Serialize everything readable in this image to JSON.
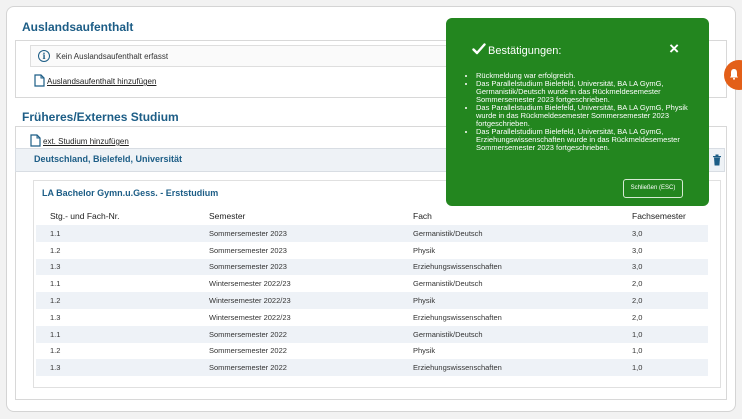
{
  "auslandsaufenthalt": {
    "title": "Auslandsaufenthalt",
    "empty_text": "Kein Auslandsaufenthalt erfasst",
    "add_link": "Auslandsaufenthalt hinzufügen"
  },
  "studium": {
    "title": "Früheres/Externes Studium",
    "add_link": "ext. Studium hinzufügen",
    "institution": "Deutschland, Bielefeld, Universität",
    "program": "LA Bachelor Gymn.u.Gess. - Erststudium",
    "columns": [
      "Stg.- und Fach-Nr.",
      "Semester",
      "Fach",
      "Fachsemester"
    ],
    "rows": [
      [
        "1.1",
        "Sommersemester 2023",
        "Germanistik/Deutsch",
        "3,0"
      ],
      [
        "1.2",
        "Sommersemester 2023",
        "Physik",
        "3,0"
      ],
      [
        "1.3",
        "Sommersemester 2023",
        "Erziehungswissenschaften",
        "3,0"
      ],
      [
        "1.1",
        "Wintersemester 2022/23",
        "Germanistik/Deutsch",
        "2,0"
      ],
      [
        "1.2",
        "Wintersemester 2022/23",
        "Physik",
        "2,0"
      ],
      [
        "1.3",
        "Wintersemester 2022/23",
        "Erziehungswissenschaften",
        "2,0"
      ],
      [
        "1.1",
        "Sommersemester 2022",
        "Germanistik/Deutsch",
        "1,0"
      ],
      [
        "1.2",
        "Sommersemester 2022",
        "Physik",
        "1,0"
      ],
      [
        "1.3",
        "Sommersemester 2022",
        "Erziehungswissenschaften",
        "1,0"
      ]
    ]
  },
  "toast": {
    "title": "Bestätigungen:",
    "close_symbol": "×",
    "items": [
      "Rückmeldung war erfolgreich.",
      "Das Parallelstudium Bielefeld, Universität, BA LA GymG, Germanistik/Deutsch wurde in das Rückmeldesemester Sommersemester 2023 fortgeschrieben.",
      "Das Parallelstudium Bielefeld, Universität, BA LA GymG, Physik wurde in das Rückmeldesemester Sommersemester 2023 fortgeschrieben.",
      "Das Parallelstudium Bielefeld, Universität, BA LA GymG, Erziehungswissenschaften wurde in das Rückmeldesemester Sommersemester 2023 fortgeschrieben."
    ],
    "close_button": "Schließen (ESC)"
  },
  "colors": {
    "accent": "#1c5d86",
    "toast_green": "#23861f",
    "bell_orange": "#e35f18"
  }
}
